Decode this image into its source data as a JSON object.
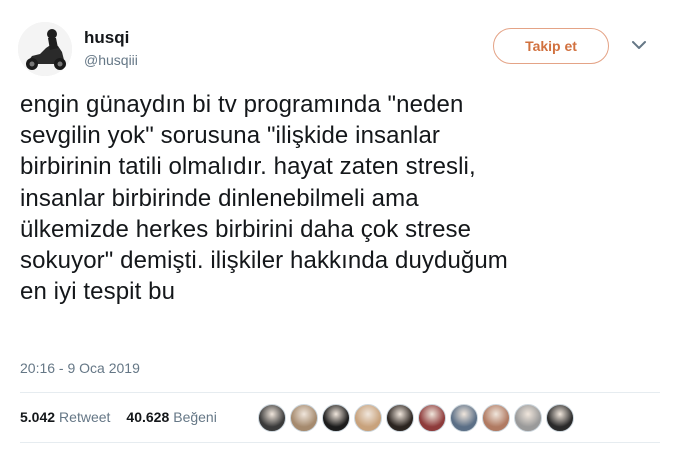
{
  "author": {
    "name": "husqi",
    "handle": "@husqiii"
  },
  "follow_button": {
    "label": "Takip et"
  },
  "menu": {
    "icon": "chevron-down-icon"
  },
  "tweet": {
    "lines": [
      "engin günaydın bi tv programında \"neden",
      "sevgilin yok\" sorusuna \"ilişkide insanlar",
      "birbirinin tatili olmalıdır. hayat zaten stresli,",
      "insanlar birbirinde dinlenebilmeli ama",
      "ülkemizde herkes birbirini daha çok strese",
      "sokuyor\" demişti. ilişkiler hakkında duyduğum",
      "en iyi tespit bu"
    ],
    "timestamp": "20:16 - 9 Oca 2019"
  },
  "stats": {
    "retweet_count": "5.042",
    "retweet_label": "Retweet",
    "like_count": "40.628",
    "like_label": "Beğeni"
  },
  "colors": {
    "follow_accent": "#d1713f",
    "follow_border": "#e4a386",
    "secondary_text": "#657786",
    "divider": "#e6ecf0"
  },
  "liker_avatars": [
    {
      "icon": "user-avatar-icon",
      "color": "#3a3a3a"
    },
    {
      "icon": "user-avatar-icon",
      "color": "#a58a6e"
    },
    {
      "icon": "user-avatar-icon",
      "color": "#1c1c1c"
    },
    {
      "icon": "user-avatar-icon",
      "color": "#c8a27c"
    },
    {
      "icon": "user-avatar-icon",
      "color": "#2b2420"
    },
    {
      "icon": "user-avatar-icon",
      "color": "#8e3b3b"
    },
    {
      "icon": "user-avatar-icon",
      "color": "#5b6f86"
    },
    {
      "icon": "user-avatar-icon",
      "color": "#b07a62"
    },
    {
      "icon": "user-avatar-icon",
      "color": "#9a9a9a"
    },
    {
      "icon": "user-avatar-icon",
      "color": "#2a2a2a"
    }
  ]
}
